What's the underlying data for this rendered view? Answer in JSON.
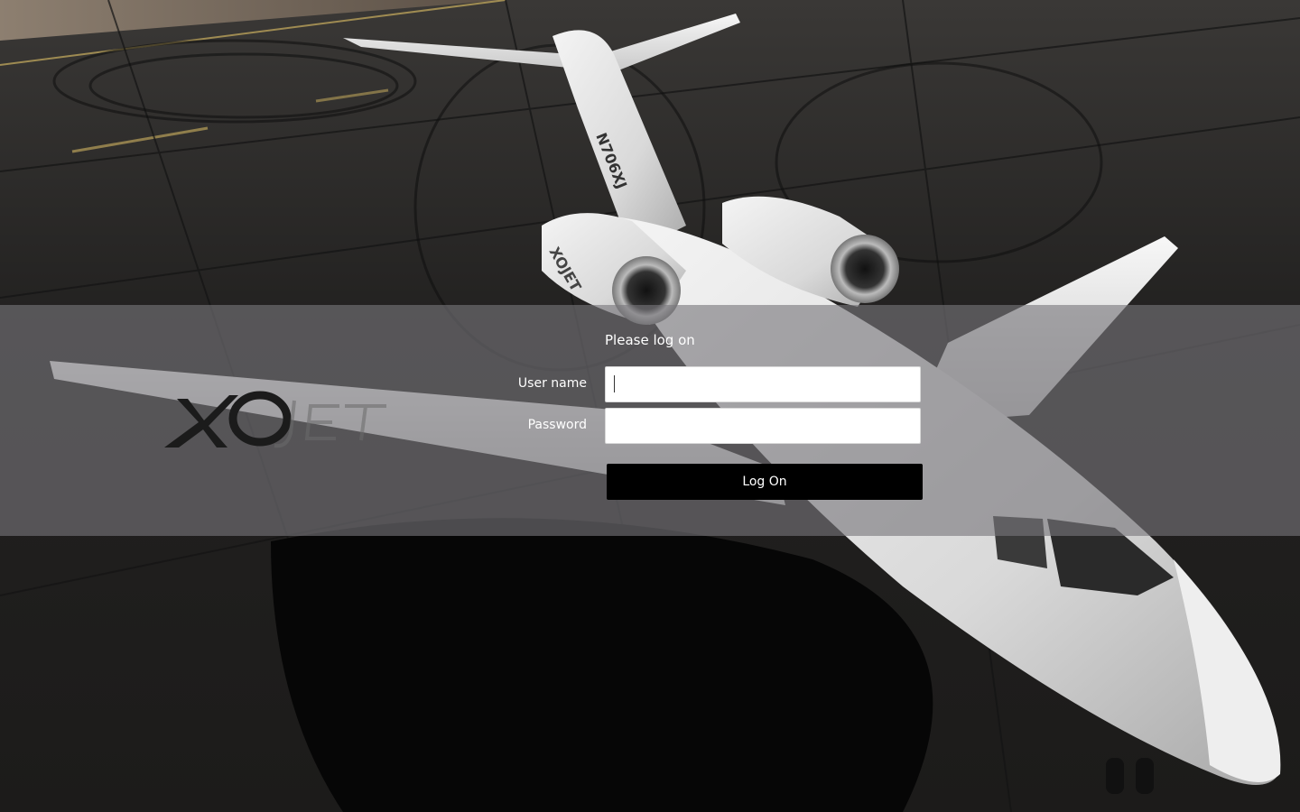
{
  "login": {
    "title": "Please log on",
    "username_label": "User name",
    "username_value": "",
    "password_label": "Password",
    "password_value": "",
    "button_label": "Log On"
  },
  "brand": {
    "logo_icon": "xojet-logo",
    "tail_number": "N706XJ",
    "engine_text": "XOJET"
  },
  "colors": {
    "band": "#78767A",
    "button": "#000000",
    "input_bg": "#FFFFFF",
    "text": "#FFFFFF"
  }
}
